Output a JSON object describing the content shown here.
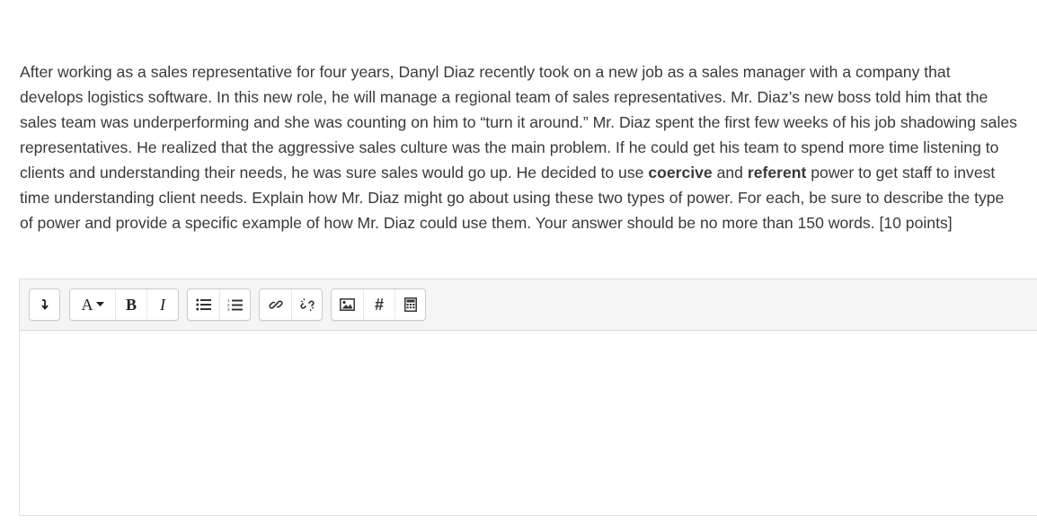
{
  "question": {
    "text_1": "After working as a sales representative for four years, Danyl Diaz recently took on a new job as a sales manager with a company that develops logistics software. In this new role, he will manage a regional team of sales representatives. Mr. Diaz’s new boss told him that the sales team was underperforming and she was counting on him to “turn it around.” Mr. Diaz spent the first few weeks of his job shadowing sales representatives. He realized that the aggressive sales culture was the main problem. If he could get his team to spend more time listening to clients and understanding their needs, he was sure sales would go up. He decided to use ",
    "bold_1": "coercive",
    "text_2": " and ",
    "bold_2": "referent",
    "text_3": " power to get staff to invest time understanding client needs. Explain how Mr. Diaz might go about using these two types of power. For each, be sure to describe the type of power and provide a specific example of how Mr. Diaz could use them. Your answer should be no more than 150 words. [10 points]"
  },
  "toolbar": {
    "show_more_icon": "arrow-down-icon",
    "font_style_label": "A",
    "bold_label": "B",
    "italic_label": "I",
    "unordered_list_icon": "bullet-list-icon",
    "ordered_list_icon": "numbered-list-icon",
    "link_icon": "link-icon",
    "unlink_icon": "unlink-icon",
    "image_icon": "image-icon",
    "hashtag_label": "#",
    "equation_icon": "calculator-icon"
  },
  "editor": {
    "content": ""
  }
}
